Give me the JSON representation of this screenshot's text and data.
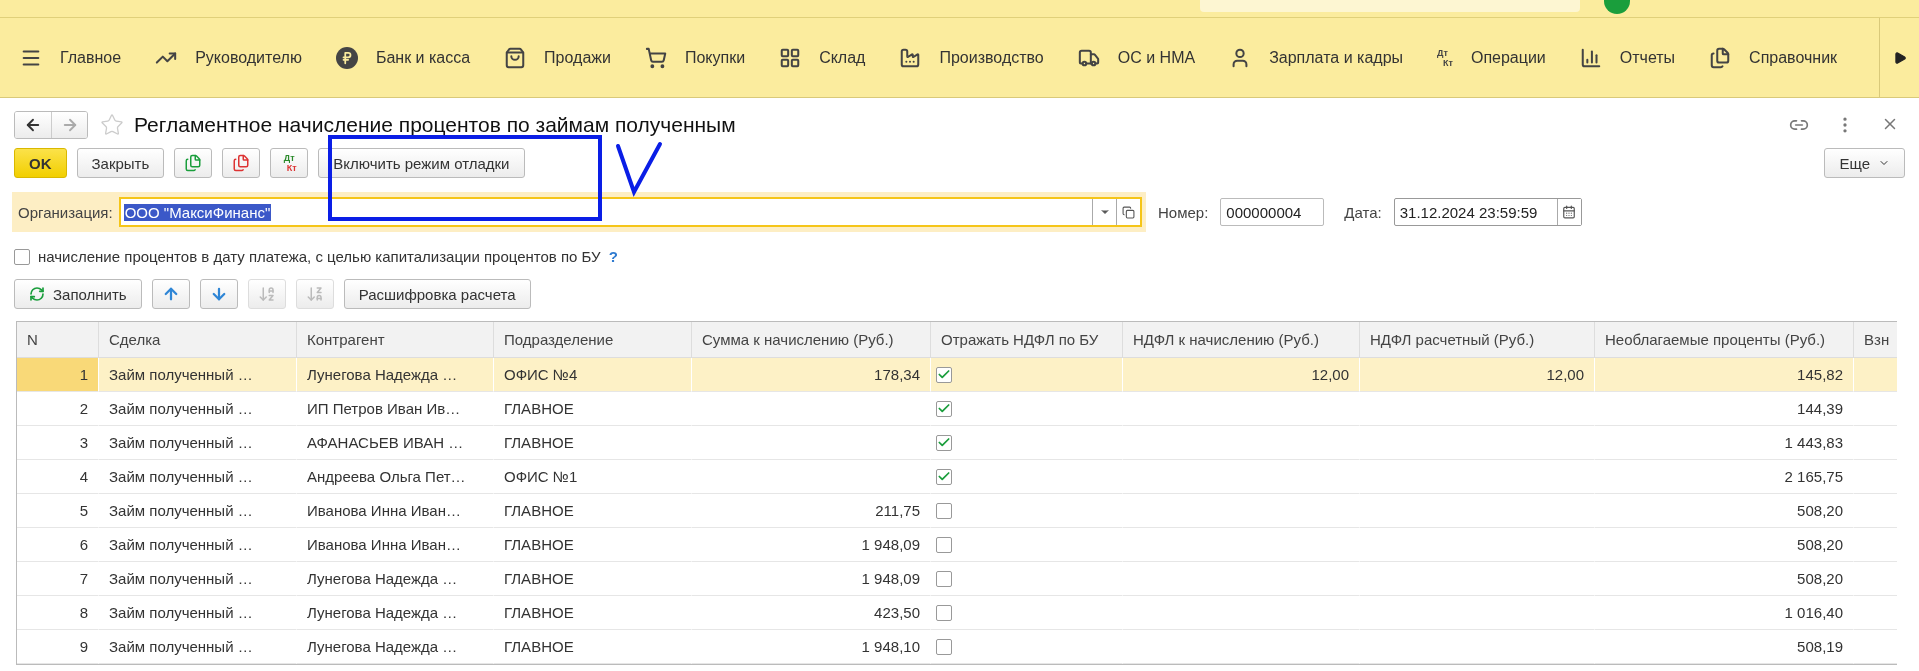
{
  "nav": [
    {
      "kind": "menu",
      "label": "Главное"
    },
    {
      "kind": "trend",
      "label": "Руководителю"
    },
    {
      "kind": "ruble",
      "label": "Банк и касса"
    },
    {
      "kind": "bag",
      "label": "Продажи"
    },
    {
      "kind": "cart",
      "label": "Покупки"
    },
    {
      "kind": "grid",
      "label": "Склад"
    },
    {
      "kind": "factory",
      "label": "Производство"
    },
    {
      "kind": "truck",
      "label": "ОС и НМА"
    },
    {
      "kind": "person",
      "label": "Зарплата и кадры"
    },
    {
      "kind": "dtkt",
      "label": "Операции",
      "icon_top": "Дт",
      "icon_bottom": "Кт"
    },
    {
      "kind": "chart",
      "label": "Отчеты"
    },
    {
      "kind": "books",
      "label": "Справочник"
    }
  ],
  "window": {
    "title": "Регламентное начисление процентов по займам полученным",
    "favorite": false
  },
  "toolbar": {
    "ok": "OK",
    "close": "Закрыть",
    "dt": "Дт",
    "kt": "Кт",
    "debug": "Включить режим отладки",
    "more": "Еще"
  },
  "organization": {
    "label": "Организация:",
    "value": "ООО \"МаксиФинанс\"",
    "text_selected": true
  },
  "number": {
    "label": "Номер:",
    "value": "000000004"
  },
  "date": {
    "label": "Дата:",
    "value": "31.12.2024 23:59:59"
  },
  "capitalize": {
    "label": "начисление процентов в дату платежа, с целью капитализации процентов по БУ",
    "checked": false,
    "help": "?"
  },
  "fill_toolbar": {
    "fill": "Заполнить",
    "sort_disabled": true,
    "details": "Расшифровка расчета"
  },
  "table": {
    "columns": [
      "N",
      "Сделка",
      "Контрагент",
      "Подразделение",
      "Сумма к начислению (Руб.)",
      "Отражать НДФЛ по БУ",
      "НДФЛ к начислению (Руб.)",
      "НДФЛ расчетный (Руб.)",
      "Необлагаемые проценты (Руб.)",
      "Взн"
    ],
    "rows": [
      {
        "selected": true,
        "n": "1",
        "deal": "Займ полученный …",
        "counterparty": "Лунегова Надежда …",
        "division": "ОФИС №4",
        "amount": "178,34",
        "checked": true,
        "ndfl": "12,00",
        "ndfl_calc": "12,00",
        "untaxed": "145,82"
      },
      {
        "selected": false,
        "n": "2",
        "deal": "Займ полученный …",
        "counterparty": "ИП Петров Иван Ив…",
        "division": "ГЛАВНОЕ",
        "checked": true,
        "untaxed": "144,39"
      },
      {
        "selected": false,
        "n": "3",
        "deal": "Займ полученный …",
        "counterparty": "АФАНАСЬЕВ ИВАН …",
        "division": "ГЛАВНОЕ",
        "checked": true,
        "untaxed": "1 443,83"
      },
      {
        "selected": false,
        "n": "4",
        "deal": "Займ полученный …",
        "counterparty": "Андреева Ольга Пет…",
        "division": "ОФИС №1",
        "checked": true,
        "untaxed": "2 165,75"
      },
      {
        "selected": false,
        "n": "5",
        "deal": "Займ полученный …",
        "counterparty": "Иванова Инна Иван…",
        "division": "ГЛАВНОЕ",
        "amount": "211,75",
        "checked": false,
        "untaxed": "508,20"
      },
      {
        "selected": false,
        "n": "6",
        "deal": "Займ полученный …",
        "counterparty": "Иванова Инна Иван…",
        "division": "ГЛАВНОЕ",
        "amount": "1 948,09",
        "checked": false,
        "untaxed": "508,20"
      },
      {
        "selected": false,
        "n": "7",
        "deal": "Займ полученный …",
        "counterparty": "Лунегова Надежда …",
        "division": "ГЛАВНОЕ",
        "amount": "1 948,09",
        "checked": false,
        "untaxed": "508,20"
      },
      {
        "selected": false,
        "n": "8",
        "deal": "Займ полученный …",
        "counterparty": "Лунегова Надежда …",
        "division": "ГЛАВНОЕ",
        "amount": "423,50",
        "checked": false,
        "untaxed": "1 016,40"
      },
      {
        "selected": false,
        "n": "9",
        "deal": "Займ полученный …",
        "counterparty": "Лунегова Надежда …",
        "division": "ГЛАВНОЕ",
        "amount": "1 948,10",
        "checked": false,
        "untaxed": "508,19"
      }
    ]
  }
}
